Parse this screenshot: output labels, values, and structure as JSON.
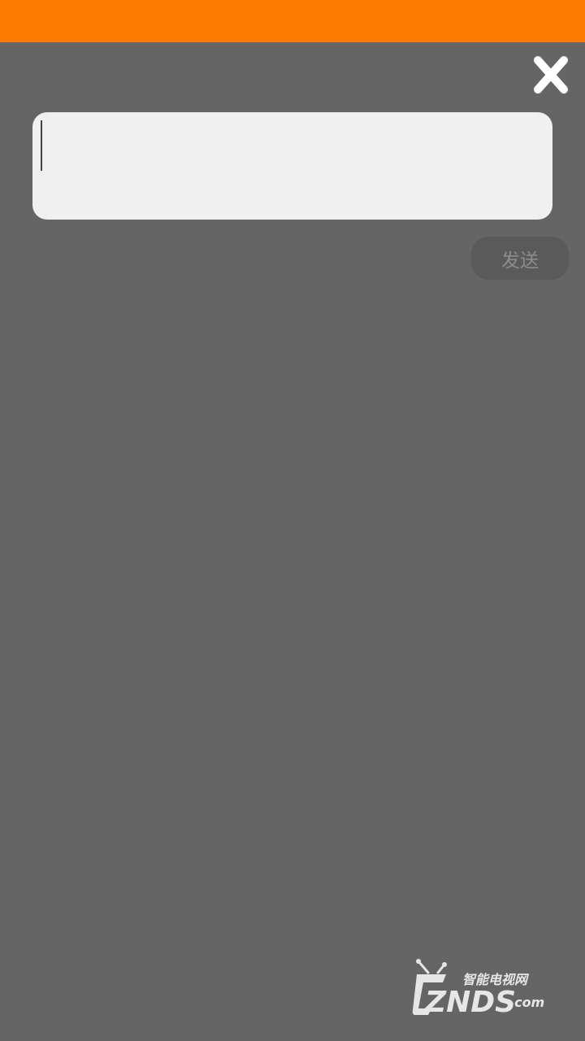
{
  "colors": {
    "status_bar": "#FF7B00",
    "background": "#656565",
    "input_background": "#F0F0F0",
    "send_button_background": "#5A5A5A",
    "send_button_text": "#8C8C8C",
    "close_icon": "#FFFFFF"
  },
  "header": {
    "close_icon": "close-icon"
  },
  "input": {
    "value": "",
    "placeholder": ""
  },
  "send_button": {
    "label": "发送"
  },
  "watermark": {
    "tagline": "智能电视网",
    "brand": "ZNDS",
    "suffix": ".com"
  }
}
